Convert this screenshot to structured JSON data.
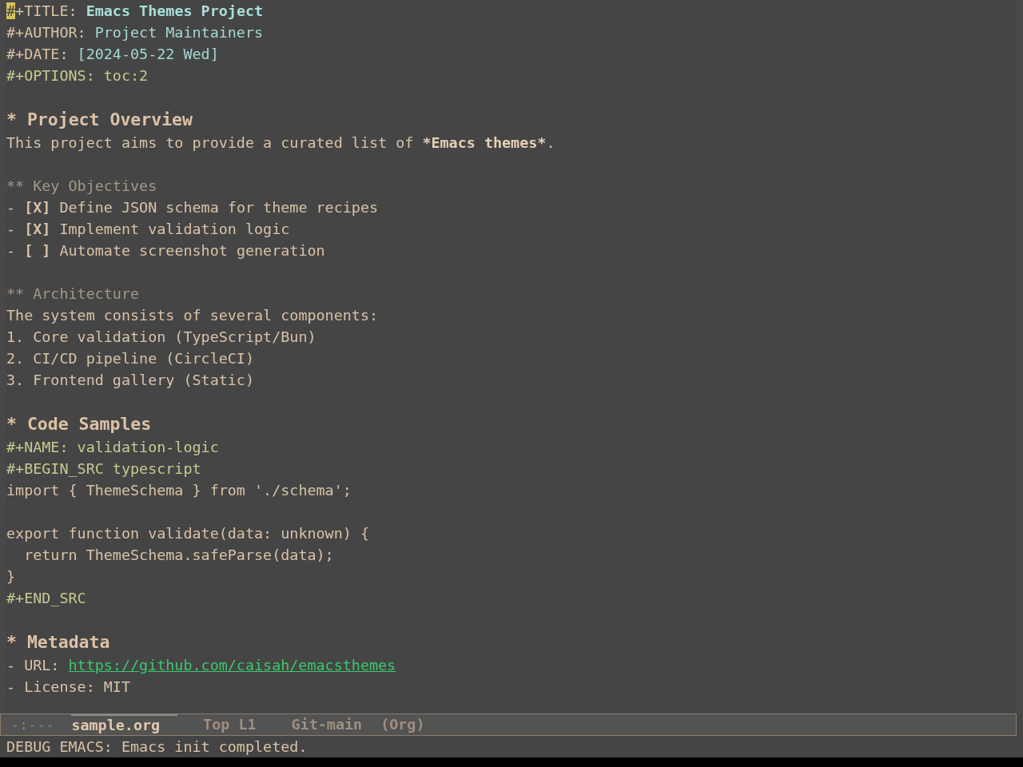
{
  "buffer": {
    "lines": [
      {
        "kind": "title",
        "key": "#+TITLE:",
        "value": "Emacs Themes Project",
        "cursor": true
      },
      {
        "kind": "info",
        "key": "#+AUTHOR:",
        "value": "Project Maintainers"
      },
      {
        "kind": "info",
        "key": "#+DATE:",
        "value": "[2024-05-22 Wed]"
      },
      {
        "kind": "directive",
        "text": "#+OPTIONS: toc:2"
      },
      {
        "kind": "blank"
      },
      {
        "kind": "h1",
        "text": "* Project Overview"
      },
      {
        "kind": "para",
        "parts": [
          {
            "text": "This project aims to provide a curated list of ",
            "strong": false
          },
          {
            "text": "*Emacs themes*",
            "strong": true
          },
          {
            "text": ".",
            "strong": false
          }
        ]
      },
      {
        "kind": "blank"
      },
      {
        "kind": "h2",
        "text": "** Key Objectives"
      },
      {
        "kind": "item",
        "text": "- **[X]** Define JSON schema for theme recipes"
      },
      {
        "kind": "item",
        "text": "- **[X]** Implement validation logic"
      },
      {
        "kind": "item",
        "text": "- **[ ]** Automate screenshot generation"
      },
      {
        "kind": "blank"
      },
      {
        "kind": "h2",
        "text": "** Architecture"
      },
      {
        "kind": "text",
        "text": "The system consists of several components:"
      },
      {
        "kind": "text",
        "text": "1. Core validation (TypeScript/Bun)"
      },
      {
        "kind": "text",
        "text": "2. CI/CD pipeline (CircleCI)"
      },
      {
        "kind": "text",
        "text": "3. Frontend gallery (Static)"
      },
      {
        "kind": "blank"
      },
      {
        "kind": "h1",
        "text": "* Code Samples"
      },
      {
        "kind": "directive",
        "text": "#+NAME: validation-logic"
      },
      {
        "kind": "directive",
        "text": "#+BEGIN_SRC typescript"
      },
      {
        "kind": "code",
        "text": "import { ThemeSchema } from './schema';"
      },
      {
        "kind": "blank"
      },
      {
        "kind": "code",
        "text": "export function validate(data: unknown) {"
      },
      {
        "kind": "code",
        "text": "  return ThemeSchema.safeParse(data);"
      },
      {
        "kind": "code",
        "text": "}"
      },
      {
        "kind": "directive",
        "text": "#+END_SRC"
      },
      {
        "kind": "blank"
      },
      {
        "kind": "h1",
        "text": "* Metadata"
      },
      {
        "kind": "link",
        "label": "- URL:",
        "url": "https://github.com/caisah/emacsthemes"
      },
      {
        "kind": "text",
        "text": "- License: MIT"
      }
    ]
  },
  "mode_line": {
    "status": "-:---",
    "buffer_name": "sample.org",
    "position": "Top L1",
    "branch": "Git-main",
    "mode": "(Org)"
  },
  "echo_area": {
    "message": "DEBUG EMACS: Emacs init completed."
  }
}
